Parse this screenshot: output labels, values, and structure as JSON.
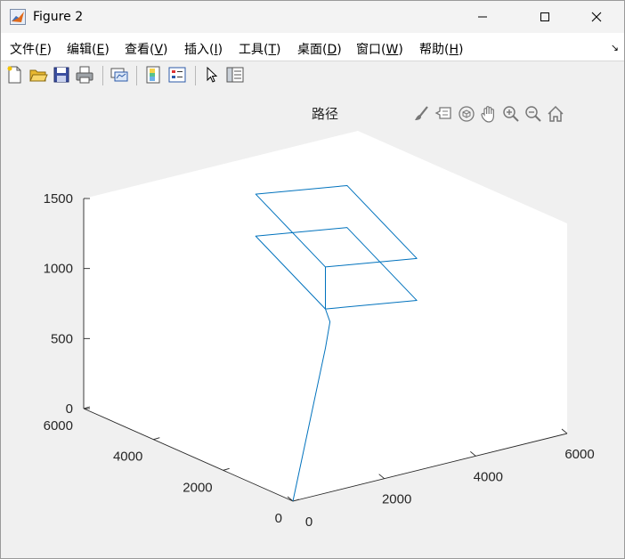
{
  "window": {
    "title": "Figure 2",
    "icons": {
      "app": "matlab-icon",
      "minimize": "minimize-icon",
      "maximize": "maximize-icon",
      "close": "close-icon"
    }
  },
  "menu": {
    "items": [
      {
        "label": "文件(",
        "key": "F",
        "tail": ")"
      },
      {
        "label": "编辑(",
        "key": "E",
        "tail": ")"
      },
      {
        "label": "查看(",
        "key": "V",
        "tail": ")"
      },
      {
        "label": "插入(",
        "key": "I",
        "tail": ")"
      },
      {
        "label": "工具(",
        "key": "T",
        "tail": ")"
      },
      {
        "label": "桌面(",
        "key": "D",
        "tail": ")"
      },
      {
        "label": "窗口(",
        "key": "W",
        "tail": ")"
      },
      {
        "label": "帮助(",
        "key": "H",
        "tail": ")"
      }
    ],
    "more_glyph": "↘"
  },
  "toolbar": {
    "buttons": [
      "new-figure-icon",
      "open-file-icon",
      "save-icon",
      "print-icon",
      "link-plot-icon",
      "insert-colorbar-icon",
      "insert-legend-icon",
      "edit-plot-icon",
      "property-inspector-icon"
    ]
  },
  "axes_toolbar": {
    "buttons": [
      "brush-icon",
      "data-tips-icon",
      "rotate-3d-icon",
      "pan-icon",
      "zoom-in-icon",
      "zoom-out-icon",
      "home-icon"
    ]
  },
  "chart_data": {
    "type": "line3d",
    "title": "路径",
    "xlabel": "",
    "ylabel": "",
    "zlabel": "",
    "xlim": [
      0,
      6000
    ],
    "ylim": [
      0,
      6000
    ],
    "zlim": [
      0,
      1500
    ],
    "xticks": [
      0,
      2000,
      4000,
      6000
    ],
    "yticks": [
      0,
      2000,
      4000,
      6000
    ],
    "zticks": [
      0,
      500,
      1000,
      1500
    ],
    "tick_labels": {
      "x": [
        "0",
        "2000",
        "4000",
        "6000"
      ],
      "y": [
        "0",
        "2000",
        "4000",
        "6000"
      ],
      "z": [
        "0",
        "500",
        "1000",
        "1500"
      ]
    },
    "line_color": "#0072BD",
    "series": [
      {
        "points": [
          [
            0,
            0,
            0
          ],
          [
            3000,
            3000,
            520
          ],
          [
            3100,
            3000,
            700
          ],
          [
            3000,
            3000,
            800
          ],
          [
            3000,
            3000,
            1100
          ],
          [
            5000,
            3000,
            1000
          ],
          [
            5000,
            5000,
            1300
          ],
          [
            3000,
            5000,
            1400
          ],
          [
            3000,
            3000,
            1100
          ],
          [
            3000,
            3000,
            800
          ],
          [
            5000,
            3000,
            700
          ],
          [
            5000,
            5000,
            1000
          ],
          [
            3000,
            5000,
            1100
          ],
          [
            3000,
            3000,
            800
          ]
        ]
      }
    ]
  }
}
